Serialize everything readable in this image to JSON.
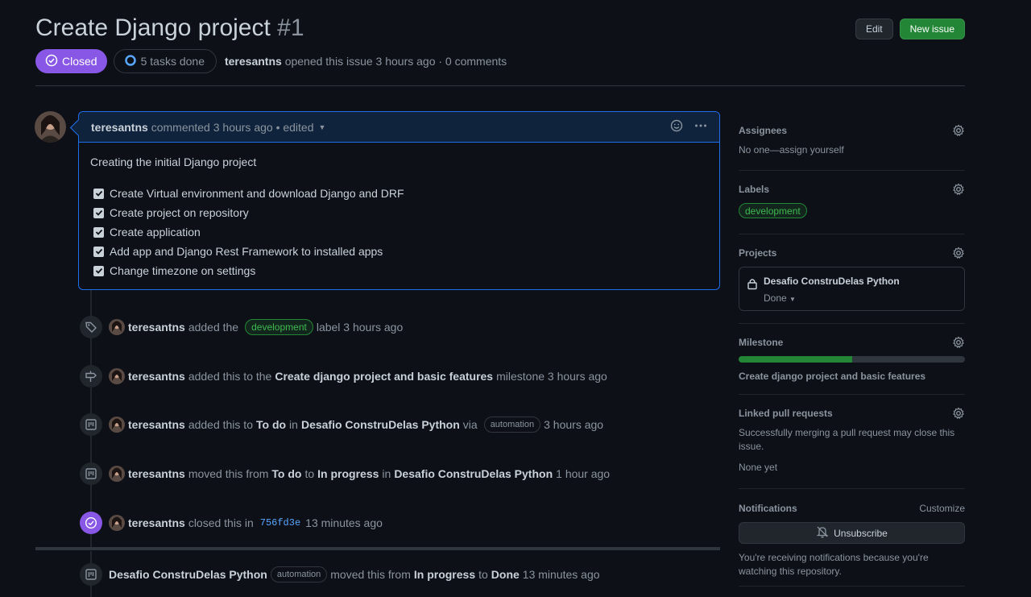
{
  "issue": {
    "title": "Create Django project",
    "number": "#1",
    "state": "Closed",
    "tasks": "5 tasks done",
    "author": "teresantns",
    "opened_text": "opened this issue 3 hours ago · 0 comments"
  },
  "header": {
    "edit_label": "Edit",
    "new_issue_label": "New issue"
  },
  "comment": {
    "author": "teresantns",
    "meta": "commented 3 hours ago • edited",
    "body": "Creating the initial Django project",
    "tasks": [
      "Create Virtual environment and download Django and DRF",
      "Create project on repository",
      "Create application",
      "Add app and Django Rest Framework to installed apps",
      "Change timezone on settings"
    ]
  },
  "events": {
    "label": {
      "actor": "teresantns",
      "pre": "added the",
      "label": "development",
      "post": "label 3 hours ago"
    },
    "milestone": {
      "actor": "teresantns",
      "pre": "added this to the",
      "milestone": "Create django project and basic features",
      "post": "milestone 3 hours ago"
    },
    "project_add": {
      "actor": "teresantns",
      "pre": "added this to",
      "column": "To do",
      "in": "in",
      "project": "Desafio ConstruDelas Python",
      "via": "via",
      "bot": "automation",
      "post": "3 hours ago"
    },
    "project_move": {
      "actor": "teresantns",
      "pre": "moved this from",
      "from": "To do",
      "to_word": "to",
      "to": "In progress",
      "in": "in",
      "project": "Desafio ConstruDelas Python",
      "post": "1 hour ago"
    },
    "closed": {
      "actor": "teresantns",
      "pre": "closed this in",
      "sha": "756fd3e",
      "post": "13 minutes ago"
    },
    "bot_move": {
      "project": "Desafio ConstruDelas Python",
      "bot": "automation",
      "pre": "moved this from",
      "from": "In progress",
      "to_word": "to",
      "to": "Done",
      "post": "13 minutes ago"
    }
  },
  "sidebar": {
    "assignees": {
      "heading": "Assignees",
      "value": "No one—assign yourself"
    },
    "labels": {
      "heading": "Labels",
      "items": [
        "development"
      ]
    },
    "projects": {
      "heading": "Projects",
      "name": "Desafio ConstruDelas Python",
      "status": "Done"
    },
    "milestone": {
      "heading": "Milestone",
      "progress": 0.5,
      "name": "Create django project and basic features"
    },
    "linked_prs": {
      "heading": "Linked pull requests",
      "desc": "Successfully merging a pull request may close this issue.",
      "value": "None yet"
    },
    "notifications": {
      "heading": "Notifications",
      "customize": "Customize",
      "button": "Unsubscribe",
      "desc": "You're receiving notifications because you're watching this repository."
    }
  },
  "colors": {
    "closed": "#8957e5",
    "primary": "#238636",
    "accent": "#1f6feb",
    "link": "#58a6ff",
    "label_green": "#3fb950"
  }
}
